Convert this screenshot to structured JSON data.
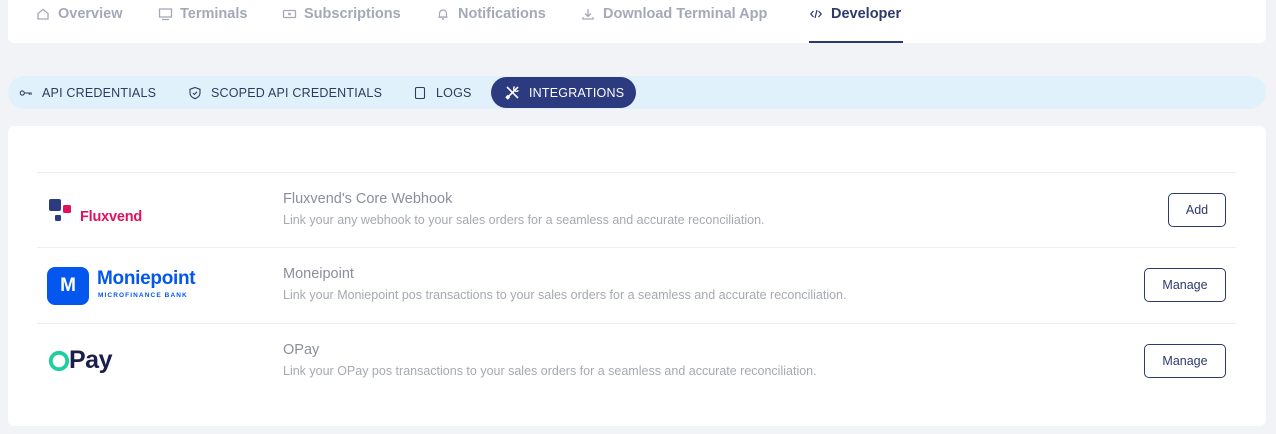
{
  "topnav": {
    "tabs": [
      {
        "label": "Overview",
        "icon": "home-icon"
      },
      {
        "label": "Terminals",
        "icon": "monitor-icon"
      },
      {
        "label": "Subscriptions",
        "icon": "card-icon"
      },
      {
        "label": "Notifications",
        "icon": "bell-icon"
      },
      {
        "label": "Download Terminal App",
        "icon": "download-icon"
      },
      {
        "label": "Developer",
        "icon": "code-icon",
        "active": true
      }
    ]
  },
  "subtabs": [
    {
      "label": "API CREDENTIALS",
      "icon": "key-icon"
    },
    {
      "label": "SCOPED API CREDENTIALS",
      "icon": "shield-icon"
    },
    {
      "label": "LOGS",
      "icon": "document-icon"
    },
    {
      "label": "INTEGRATIONS",
      "icon": "tools-icon",
      "active": true
    }
  ],
  "integrations": [
    {
      "logo_text": "Fluxvend",
      "name": "Fluxvend's Core Webhook",
      "description": "Link your any webhook to your sales orders for a seamless and accurate reconciliation.",
      "action": "Add"
    },
    {
      "logo_text": "Moniepoint",
      "logo_subtext": "MICROFINANCE BANK",
      "logo_mark": "M",
      "name": "Moneipoint",
      "description": "Link your Moniepoint pos transactions to your sales orders for a seamless and accurate reconciliation.",
      "action": "Manage"
    },
    {
      "logo_text": "Pay",
      "name": "OPay",
      "description": "Link your OPay pos transactions to your sales orders for a seamless and accurate reconciliation.",
      "action": "Manage"
    }
  ],
  "colors": {
    "primary": "#2c3a6b",
    "subbar": "#e0f1fc",
    "active_pill": "#2c3a80",
    "fluxvend_pink": "#e0115f",
    "moniepoint_blue": "#0357ee",
    "opay_green": "#1dcf9f",
    "opay_navy": "#1b1d4a"
  }
}
